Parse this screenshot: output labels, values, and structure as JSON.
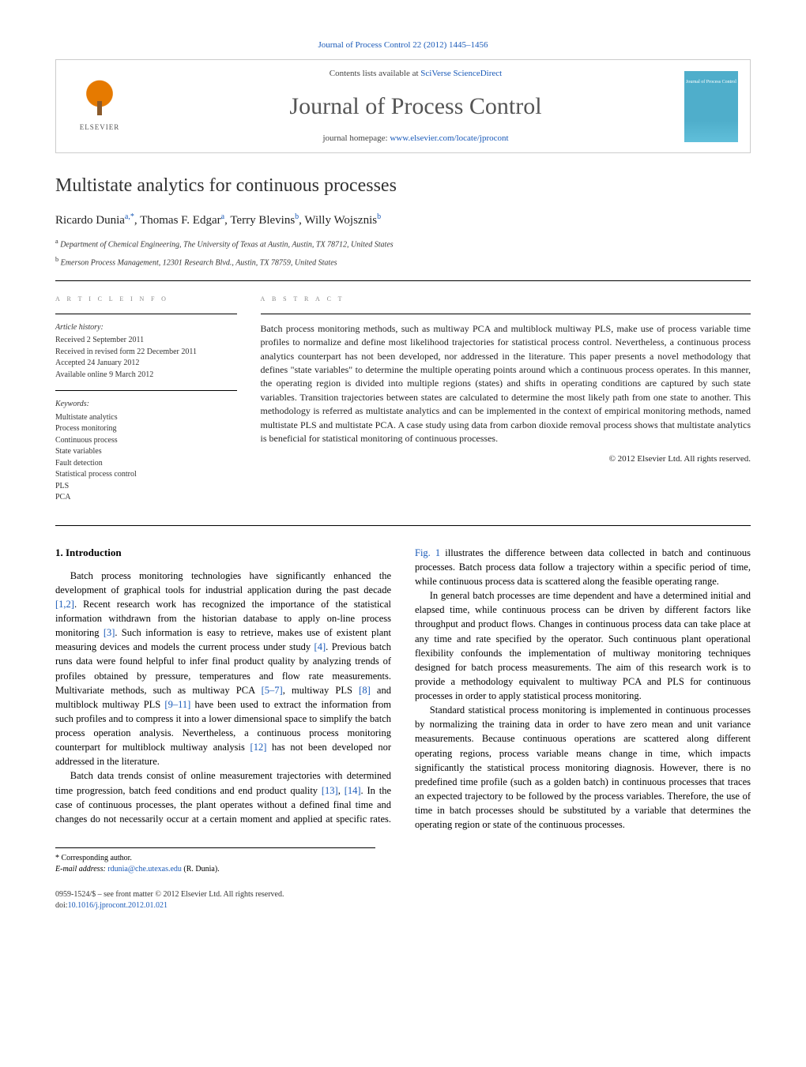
{
  "header": {
    "journal_ref": "Journal of Process Control 22 (2012) 1445–1456",
    "contents_line_prefix": "Contents lists available at ",
    "contents_link": "SciVerse ScienceDirect",
    "journal_name": "Journal of Process Control",
    "homepage_prefix": "journal homepage: ",
    "homepage_link": "www.elsevier.com/locate/jprocont",
    "publisher": "ELSEVIER",
    "cover_text": "Journal of Process Control"
  },
  "article": {
    "title": "Multistate analytics for continuous processes",
    "authors_html": "Ricardo Dunia",
    "author1": "Ricardo Dunia",
    "author1_sup": "a,*",
    "author2": "Thomas F. Edgar",
    "author2_sup": "a",
    "author3": "Terry Blevins",
    "author3_sup": "b",
    "author4": "Willy Wojsznis",
    "author4_sup": "b",
    "affil_a": "Department of Chemical Engineering, The University of Texas at Austin, Austin, TX 78712, United States",
    "affil_b": "Emerson Process Management, 12301 Research Blvd., Austin, TX 78759, United States"
  },
  "info": {
    "heading": "a r t i c l e   i n f o",
    "history_label": "Article history:",
    "received": "Received 2 September 2011",
    "revised": "Received in revised form 22 December 2011",
    "accepted": "Accepted 24 January 2012",
    "online": "Available online 9 March 2012",
    "keywords_label": "Keywords:",
    "keywords": [
      "Multistate analytics",
      "Process monitoring",
      "Continuous process",
      "State variables",
      "Fault detection",
      "Statistical process control",
      "PLS",
      "PCA"
    ]
  },
  "abstract": {
    "heading": "a b s t r a c t",
    "text": "Batch process monitoring methods, such as multiway PCA and multiblock multiway PLS, make use of process variable time profiles to normalize and define most likelihood trajectories for statistical process control. Nevertheless, a continuous process analytics counterpart has not been developed, nor addressed in the literature. This paper presents a novel methodology that defines \"state variables\" to determine the multiple operating points around which a continuous process operates. In this manner, the operating region is divided into multiple regions (states) and shifts in operating conditions are captured by such state variables. Transition trajectories between states are calculated to determine the most likely path from one state to another. This methodology is referred as multistate analytics and can be implemented in the context of empirical monitoring methods, named multistate PLS and multistate PCA. A case study using data from carbon dioxide removal process shows that multistate analytics is beneficial for statistical monitoring of continuous processes.",
    "copyright": "© 2012 Elsevier Ltd. All rights reserved."
  },
  "body": {
    "section1_heading": "1. Introduction",
    "p1a": "Batch process monitoring technologies have significantly enhanced the development of graphical tools for industrial application during the past decade ",
    "p1_ref1": "[1,2]",
    "p1b": ". Recent research work has recognized the importance of the statistical information withdrawn from the historian database to apply on-line process monitoring ",
    "p1_ref2": "[3]",
    "p1c": ". Such information is easy to retrieve, makes use of existent plant measuring devices and models the current process under study ",
    "p1_ref3": "[4]",
    "p1d": ". Previous batch runs data were found helpful to infer final product quality by analyzing trends of profiles obtained by pressure, temperatures and flow rate measurements. Multivariate methods, such as multiway PCA ",
    "p1_ref4": "[5–7]",
    "p1e": ", multiway PLS ",
    "p1_ref5": "[8]",
    "p1f": " and multiblock multiway PLS ",
    "p1_ref6": "[9–11]",
    "p1g": " have been used to extract the information from such profiles and to compress it into a lower dimensional space to simplify the batch process operation analysis. Nevertheless, a continuous process monitoring counterpart for multiblock multiway analysis ",
    "p1_ref7": "[12]",
    "p1h": " has not been developed nor addressed in the literature.",
    "p2a": "Batch data trends consist of online measurement trajectories with determined time progression, batch feed conditions and end product quality ",
    "p2_ref1": "[13]",
    "p2b": ", ",
    "p2_ref2": "[14]",
    "p2c": ". In the case of continuous processes, the plant operates without a defined final time and changes do not necessarily occur at a certain moment and applied at specific rates. ",
    "p2_fig": "Fig. 1",
    "p2d": " illustrates the difference between data collected in batch and continuous processes. Batch process data follow a trajectory within a specific period of time, while continuous process data is scattered along the feasible operating range.",
    "p3": "In general batch processes are time dependent and have a determined initial and elapsed time, while continuous process can be driven by different factors like throughput and product flows. Changes in continuous process data can take place at any time and rate specified by the operator. Such continuous plant operational flexibility confounds the implementation of multiway monitoring techniques designed for batch process measurements. The aim of this research work is to provide a methodology equivalent to multiway PCA and PLS for continuous processes in order to apply statistical process monitoring.",
    "p4": "Standard statistical process monitoring is implemented in continuous processes by normalizing the training data in order to have zero mean and unit variance measurements. Because continuous operations are scattered along different operating regions, process variable means change in time, which impacts significantly the statistical process monitoring diagnosis. However, there is no predefined time profile (such as a golden batch) in continuous processes that traces an expected trajectory to be followed by the process variables. Therefore, the use of time in batch processes should be substituted by a variable that determines the operating region or state of the continuous processes."
  },
  "footnotes": {
    "corr_label": "* Corresponding author.",
    "email_label": "E-mail address: ",
    "email": "rdunia@che.utexas.edu",
    "email_person": " (R. Dunia)."
  },
  "bottom": {
    "issn": "0959-1524/$ – see front matter © 2012 Elsevier Ltd. All rights reserved.",
    "doi_prefix": "doi:",
    "doi": "10.1016/j.jprocont.2012.01.021"
  }
}
